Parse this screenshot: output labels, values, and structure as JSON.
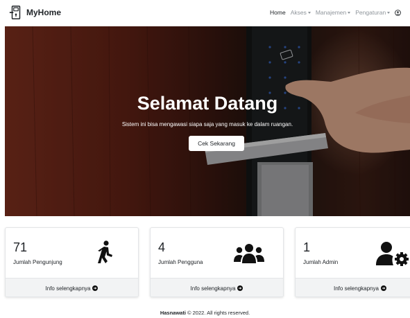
{
  "brand": {
    "name": "MyHome",
    "icon": "door-lock-icon"
  },
  "nav": {
    "items": [
      {
        "label": "Home",
        "active": true,
        "dropdown": false
      },
      {
        "label": "Akses",
        "active": false,
        "dropdown": true
      },
      {
        "label": "Manajemen",
        "active": false,
        "dropdown": true
      },
      {
        "label": "Pengaturan",
        "active": false,
        "dropdown": true
      }
    ],
    "user_icon": "user-circle-icon"
  },
  "hero": {
    "title": "Selamat Datang",
    "subtitle": "Sistem ini bisa mengawasi siapa saja yang masuk ke dalam ruangan.",
    "button_label": "Cek Sekarang"
  },
  "cards": [
    {
      "value": "71",
      "label": "Jumlah Pengunjung",
      "icon": "walking-person-icon",
      "link": "Info selengkapnya"
    },
    {
      "value": "4",
      "label": "Jumlah Pengguna",
      "icon": "users-group-icon",
      "link": "Info selengkapnya"
    },
    {
      "value": "1",
      "label": "Jumlah Admin",
      "icon": "user-gear-icon",
      "link": "Info selengkapnya"
    }
  ],
  "footer": {
    "owner": "Hasnawati",
    "text": "© 2022. All rights reserved."
  },
  "colors": {
    "text": "#212529",
    "muted_nav": "#8f959b",
    "card_footer_bg": "#f2f3f4",
    "hero_wood": "#5d2014"
  }
}
